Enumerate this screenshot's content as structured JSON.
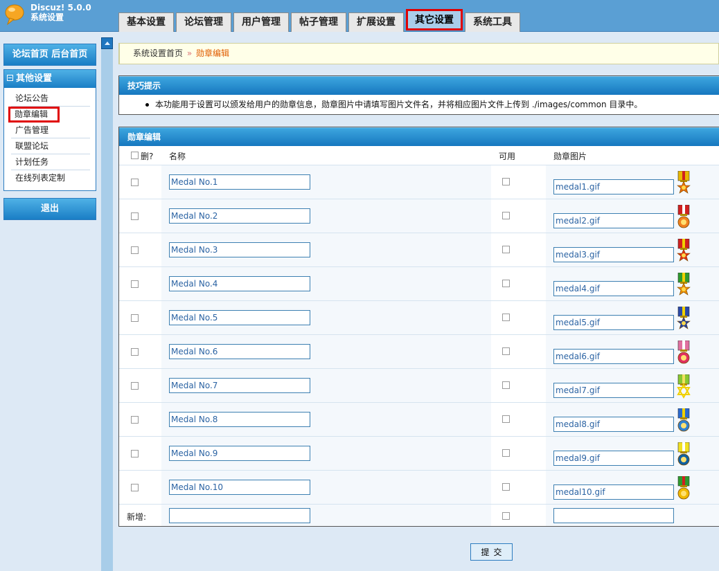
{
  "app": {
    "name": "Discuz! 5.0.0",
    "subtitle": "系统设置"
  },
  "tabs": [
    {
      "label": "基本设置",
      "active": false
    },
    {
      "label": "论坛管理",
      "active": false
    },
    {
      "label": "用户管理",
      "active": false
    },
    {
      "label": "帖子管理",
      "active": false
    },
    {
      "label": "扩展设置",
      "active": false
    },
    {
      "label": "其它设置",
      "active": true
    },
    {
      "label": "系统工具",
      "active": false
    }
  ],
  "sidebar": {
    "links_label": "论坛首页 后台首页",
    "section_title": "其他设置",
    "items": [
      {
        "label": "论坛公告",
        "active": false
      },
      {
        "label": "勋章编辑",
        "active": true
      },
      {
        "label": "广告管理",
        "active": false
      },
      {
        "label": "联盟论坛",
        "active": false
      },
      {
        "label": "计划任务",
        "active": false
      },
      {
        "label": "在线列表定制",
        "active": false
      }
    ],
    "logout_label": "退出"
  },
  "breadcrumb": {
    "home": "系统设置首页",
    "separator": "»",
    "current": "勋章编辑"
  },
  "tips": {
    "title": "技巧提示",
    "text": "本功能用于设置可以颁发给用户的勋章信息，勋章图片中请填写图片文件名，并将相应图片文件上传到 ./images/common 目录中。"
  },
  "medals": {
    "title": "勋章编辑",
    "headers": {
      "delete": "删?",
      "name": "名称",
      "available": "可用",
      "image": "勋章图片"
    },
    "rows": [
      {
        "name": "Medal No.1",
        "image": "medal1.gif",
        "ribbon": "#e8b800",
        "stripe": "#d02020",
        "badge": "#e86c00",
        "shape": "star"
      },
      {
        "name": "Medal No.2",
        "image": "medal2.gif",
        "ribbon": "#d02020",
        "stripe": "#ffffff",
        "badge": "#f08020",
        "shape": "circle"
      },
      {
        "name": "Medal No.3",
        "image": "medal3.gif",
        "ribbon": "#d02020",
        "stripe": "#f0d000",
        "badge": "#e03010",
        "shape": "star"
      },
      {
        "name": "Medal No.4",
        "image": "medal4.gif",
        "ribbon": "#2e9a2e",
        "stripe": "#f0d000",
        "badge": "#e88a00",
        "shape": "star"
      },
      {
        "name": "Medal No.5",
        "image": "medal5.gif",
        "ribbon": "#2a4aa8",
        "stripe": "#f0d000",
        "badge": "#2040a0",
        "shape": "sun"
      },
      {
        "name": "Medal No.6",
        "image": "medal6.gif",
        "ribbon": "#e070a0",
        "stripe": "#ffffff",
        "badge": "#e03060",
        "shape": "circle"
      },
      {
        "name": "Medal No.7",
        "image": "medal7.gif",
        "ribbon": "#88c830",
        "stripe": "#f0e060",
        "badge": "#f0d000",
        "shape": "hexstar"
      },
      {
        "name": "Medal No.8",
        "image": "medal8.gif",
        "ribbon": "#2a6ad0",
        "stripe": "#f0d000",
        "badge": "#3080d0",
        "shape": "circle"
      },
      {
        "name": "Medal No.9",
        "image": "medal9.gif",
        "ribbon": "#f0e020",
        "stripe": "#ffffff",
        "badge": "#1060a0",
        "shape": "circle"
      },
      {
        "name": "Medal No.10",
        "image": "medal10.gif",
        "ribbon": "#2e9a2e",
        "stripe": "#d02020",
        "badge": "#f0b800",
        "shape": "circle"
      }
    ],
    "new_label": "新增:",
    "new_name": "",
    "new_image": ""
  },
  "submit_label": "提交"
}
